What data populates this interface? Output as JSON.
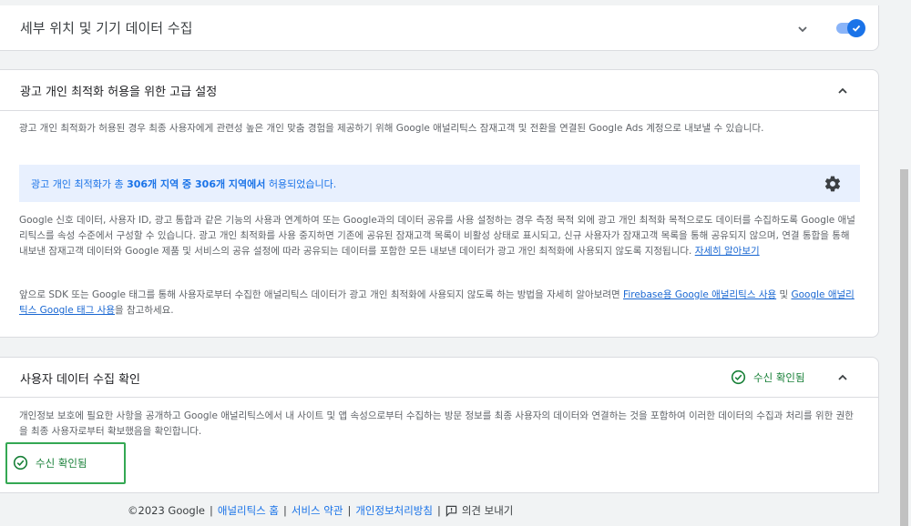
{
  "section_location": {
    "title": "세부 위치 및 기기 데이터 수집",
    "toggle_on": true
  },
  "section_ads": {
    "title": "광고 개인 최적화 허용을 위한 고급 설정",
    "desc1": "광고 개인 최적화가 허용된 경우 최종 사용자에게 관련성 높은 개인 맞춤 경험을 제공하기 위해 Google 애널리틱스 잠재고객 및 전환을 연결된 Google Ads 계정으로 내보낼 수 있습니다.",
    "banner_prefix": "광고 개인 최적화가 총 ",
    "banner_bold": "306개 지역 중 306개 지역에서",
    "banner_suffix": " 허용되었습니다.",
    "desc2": "Google 신호 데이터, 사용자 ID, 광고 통합과 같은 기능의 사용과 연계하여 또는 Google과의 데이터 공유를 사용 설정하는 경우 측정 목적 외에 광고 개인 최적화 목적으로도 데이터를 수집하도록 Google 애널리틱스를 속성 수준에서 구성할 수 있습니다. 광고 개인 최적화를 사용 중지하면 기존에 공유된 잠재고객 목록이 비활성 상태로 표시되고, 신규 사용자가 잠재고객 목록을 통해 공유되지 않으며, 연결 통합을 통해 내보낸 잠재고객 데이터와 Google 제품 및 서비스의 공유 설정에 따라 공유되는 데이터를 포함한 모든 내보낸 데이터가 광고 개인 최적화에 사용되지 않도록 지정됩니다.",
    "learn_more": "자세히 알아보기",
    "desc3_prefix": "앞으로 SDK 또는 Google 태그를 통해 사용자로부터 수집한 애널리틱스 데이터가 광고 개인 최적화에 사용되지 않도록 하는 방법을 자세히 알아보려면 ",
    "link_firebase": "Firebase용 Google 애널리틱스 사용",
    "desc3_and": " 및 ",
    "link_gtag": "Google 애널리틱스 Google 태그 사용",
    "desc3_suffix": "을 참고하세요."
  },
  "section_user_data": {
    "title": "사용자 데이터 수집 확인",
    "status": "수신 확인됨",
    "desc": "개인정보 보호에 필요한 사항을 공개하고 Google 애널리틱스에서 내 사이트 및 앱 속성으로부터 수집하는 방문 정보를 최종 사용자의 데이터와 연결하는 것을 포함하여 이러한 데이터의 수집과 처리를 위한 권한을 최종 사용자로부터 확보했음을 확인합니다.",
    "confirm_label": "수신 확인됨"
  },
  "footer": {
    "copyright": "©2023 Google",
    "sep": "|",
    "home": "애널리틱스 홈",
    "terms": "서비스 약관",
    "privacy": "개인정보처리방침",
    "feedback": "의견 보내기"
  },
  "colors": {
    "accent": "#1a73e8",
    "success": "#188038",
    "highlight_border": "#34a853",
    "banner_bg": "#e8f0fe"
  }
}
